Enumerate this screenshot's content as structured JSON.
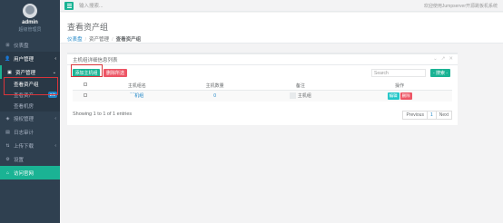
{
  "sidebar": {
    "user": {
      "name": "admin",
      "role": "超级管理员"
    },
    "items": [
      {
        "label": "仪表盘",
        "icon": "dashboard-icon",
        "glyph": "⊞"
      },
      {
        "label": "用户管理",
        "icon": "user-icon",
        "glyph": "👤",
        "arrow": "‹"
      },
      {
        "label": "资产管理",
        "icon": "asset-icon",
        "glyph": "▣",
        "arrow": "⌄"
      },
      {
        "label": "授权管理",
        "icon": "perm-icon",
        "glyph": "◈",
        "arrow": "‹"
      },
      {
        "label": "日志审计",
        "icon": "log-icon",
        "glyph": "▤"
      },
      {
        "label": "上传下载",
        "icon": "upload-icon",
        "glyph": "⇅",
        "arrow": "‹"
      },
      {
        "label": "设置",
        "icon": "gear-icon",
        "glyph": "⚙"
      },
      {
        "label": "访问官网",
        "icon": "home-icon",
        "glyph": "⌂"
      }
    ],
    "sub_items": [
      {
        "label": "查看资产组"
      },
      {
        "label": "查看资产",
        "badge": "2/2"
      },
      {
        "label": "查看机房"
      }
    ]
  },
  "topbar": {
    "search_placeholder": "输入搜索...",
    "welcome": "欢迎使用Jumpserver开源跳板机系统"
  },
  "page": {
    "title": "查看资产组",
    "breadcrumb": [
      "仪表盘",
      "资产管理",
      "查看资产组"
    ]
  },
  "panel": {
    "title": "主机组详细信息列表",
    "tools": [
      "⌄",
      "↗",
      "✕"
    ],
    "add_button": "添加主机组",
    "delete_button": "删除所选",
    "search_placeholder": "Search",
    "search_button": "- 搜索 -",
    "columns": [
      "主机组名",
      "主机数量",
      "备注",
      "操作"
    ],
    "rows": [
      {
        "name": "‾ ‾机组",
        "count": "0",
        "comment": "主机组",
        "edit": "编辑",
        "delete": "删除"
      }
    ],
    "showing": "Showing 1 to 1 of 1 entries",
    "pager": {
      "prev": "Previous",
      "page": "1",
      "next": "Next"
    }
  },
  "colors": {
    "accent": "#1ab394",
    "danger": "#ed5565",
    "sidebar": "#2f4050",
    "highlight": "#d9343a"
  }
}
